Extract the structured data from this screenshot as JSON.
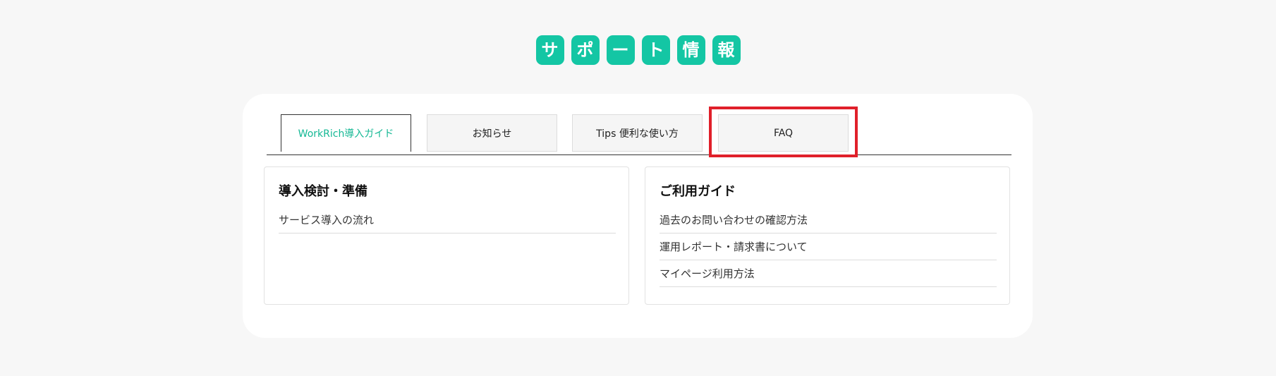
{
  "page_title_chars": [
    "サ",
    "ポ",
    "ー",
    "ト",
    "情",
    "報"
  ],
  "tabs": [
    {
      "label": "WorkRich導入ガイド",
      "active": true
    },
    {
      "label": "お知らせ",
      "active": false
    },
    {
      "label": "Tips 便利な使い方",
      "active": false
    },
    {
      "label": "FAQ",
      "active": false
    }
  ],
  "panels": {
    "left": {
      "title": "導入検討・準備",
      "items": [
        "サービス導入の流れ"
      ]
    },
    "right": {
      "title": "ご利用ガイド",
      "items": [
        "過去のお問い合わせの確認方法",
        "運用レポート・請求書について",
        "マイページ利用方法"
      ]
    }
  },
  "colors": {
    "accent": "#14c6a4",
    "active_tab_text": "#14b894",
    "highlight": "#e0202a",
    "background": "#f7f7f7"
  }
}
